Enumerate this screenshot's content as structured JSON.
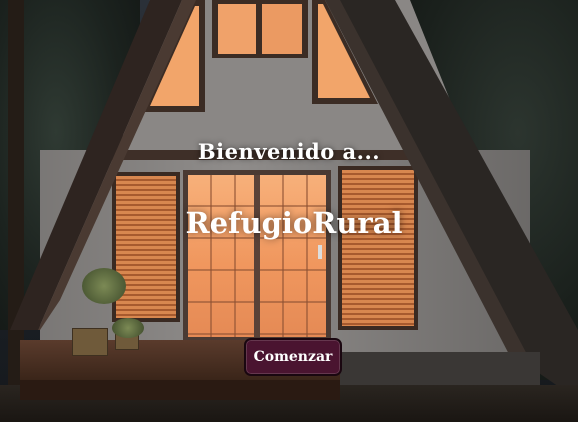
{
  "hero": {
    "welcome_text": "Bienvenido a...",
    "brand_name": "RefugioRural",
    "cta_label": "Comenzar"
  },
  "colors": {
    "cta_background": "#4a1430",
    "text": "#ffffff"
  }
}
